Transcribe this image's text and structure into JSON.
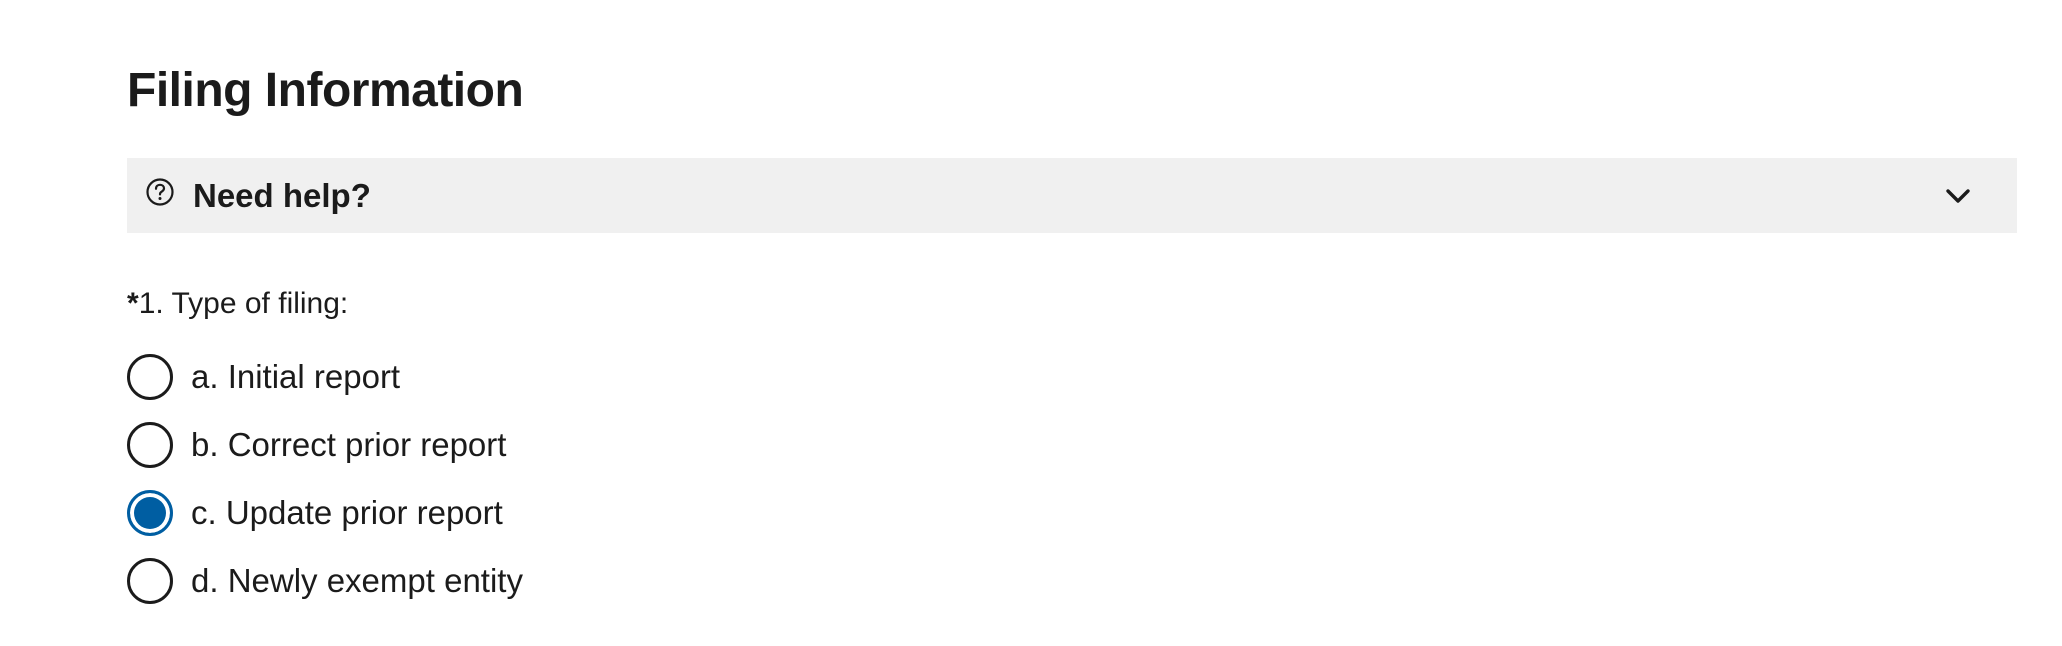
{
  "page": {
    "title": "Filing Information"
  },
  "help": {
    "label": "Need help?",
    "expanded": false,
    "icon": "question-circle-icon",
    "toggle_icon": "chevron-down-icon"
  },
  "question": {
    "required_marker": "*",
    "label": "1. Type of filing:",
    "selected": "c",
    "options": [
      {
        "key": "a",
        "label": "a. Initial report",
        "checked": false
      },
      {
        "key": "b",
        "label": "b. Correct prior report",
        "checked": false
      },
      {
        "key": "c",
        "label": "c. Update prior report",
        "checked": true
      },
      {
        "key": "d",
        "label": "d. Newly exempt entity",
        "checked": false
      }
    ]
  },
  "colors": {
    "text": "#1b1b1b",
    "accordion_bg": "#f0f0f0",
    "radio_selected": "#005ea2"
  }
}
